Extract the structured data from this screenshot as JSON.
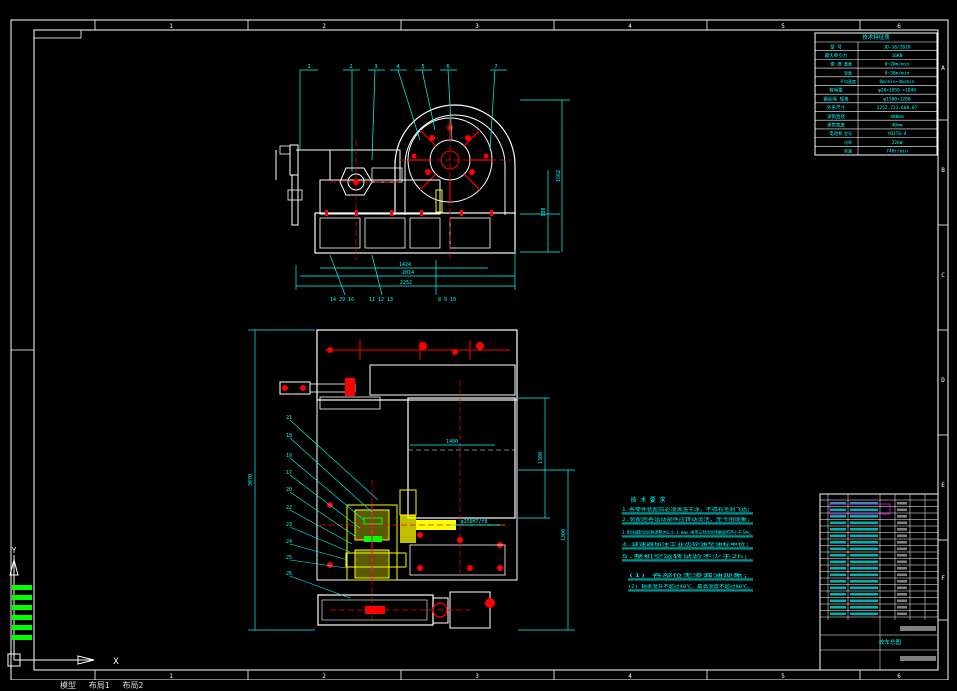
{
  "border": {
    "top_zone_numbers": [
      "1",
      "2",
      "3",
      "4",
      "5",
      "6"
    ],
    "bottom_zone_numbers": [
      "1",
      "2",
      "3",
      "4",
      "5",
      "6"
    ],
    "right_zone_letters": [
      "A",
      "B",
      "C",
      "D",
      "E",
      "F"
    ]
  },
  "spec_table": {
    "title": "技术特征表",
    "rows": [
      {
        "name": "型 号",
        "value": "JD-16/2020"
      },
      {
        "name": "最大牵引力",
        "value": "16KN"
      },
      {
        "name": "速 度",
        "sub": "重载",
        "value": "0~20m/min"
      },
      {
        "name": "",
        "sub": "轻载",
        "value": "0~30m/min"
      },
      {
        "name": "",
        "sub": "平均速度",
        "value": "8m/min~4m/min"
      },
      {
        "name": "容绳量",
        "value": "φ20×1950 ×1840"
      },
      {
        "name": "钢丝绳 规格",
        "value": "φ1500×1200"
      },
      {
        "name": "外形尺寸",
        "value": "2252.721.608.07"
      },
      {
        "name": "滚筒直径",
        "value": "400mm"
      },
      {
        "name": "滚筒宽度",
        "value": "40mm"
      },
      {
        "name": "电动机",
        "sub": "型号",
        "value": "YB3T6-4"
      },
      {
        "name": "",
        "sub": "功率",
        "value": "22kW"
      },
      {
        "name": "",
        "sub": "转速",
        "value": "740r/min"
      }
    ]
  },
  "front_view": {
    "callouts_top": [
      "1",
      "2",
      "3",
      "4",
      "5",
      "6",
      "7"
    ],
    "callouts_bottom": [
      "14 29 16",
      "11 12 13",
      "8 9 10"
    ],
    "dims": {
      "h_left": "1424",
      "h_mid": "2014",
      "h_total": "2252",
      "v_mid": "880",
      "v_total": "1562"
    }
  },
  "plan_view": {
    "callouts_left": [
      "21",
      "18",
      "19",
      "17",
      "20",
      "22",
      "23",
      "24",
      "25",
      "26"
    ],
    "dims": {
      "h_inner": "1400",
      "v_left": "3070",
      "v_right1": "1300",
      "v_right2": "1300",
      "shaft": "φ150H7/f8"
    }
  },
  "tech_requirements": {
    "title": "技 术 要 求",
    "items": [
      "1.各零件装配前必须清洗干净，不得有毛刺飞边；",
      "2.装配后各运动部件应转动灵活，无卡阻现象；",
      "3.制动器制动间隙调整为0.8-1.0mm,闸带与制动轮接触面积不小于70%；",
      "4.减速器加注工业齿轮油至油标中位；",
      "5.整机空运转试验不少于2h；",
      "(1) 各部位无渗漏油现象；",
      "(2) 轴承温升不超过40℃，最高温度不超过80℃。"
    ]
  },
  "title_block": {
    "drawing_title": "绞车总图"
  },
  "ucs": {
    "y": "Y",
    "x": "X"
  },
  "model_tabs": [
    "模型",
    "布局1",
    "布局2"
  ],
  "colors": {
    "background": "#000000",
    "outline": "#ffffff",
    "cyan": "#00ffff",
    "red": "#ff0000",
    "yellow": "#ffff00",
    "green": "#00ff00",
    "magenta": "#ff00ff"
  }
}
